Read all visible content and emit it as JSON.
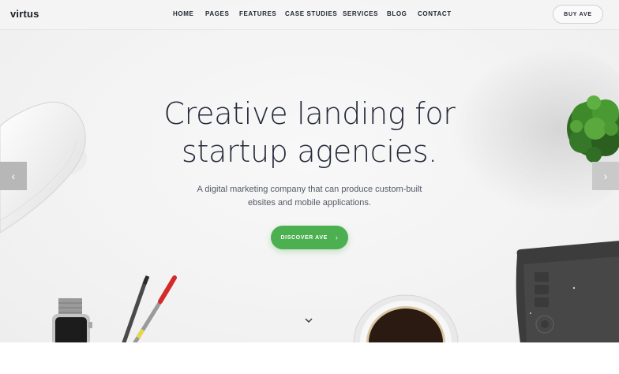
{
  "header": {
    "logo": "virtus",
    "nav": [
      "HOME",
      "PAGES",
      "FEATURES",
      "CASE STUDIES",
      "SERVICES",
      "BLOG",
      "CONTACT"
    ],
    "buy_button": "BUY AVE"
  },
  "hero": {
    "headline_line1": "Creative landing for",
    "headline_line2": "startup agencies.",
    "subtext_line1": "A digital marketing company that can produce custom-built",
    "subtext_line2": "ebsites and mobile applications.",
    "cta_label": "DISCOVER AVE",
    "cta_color": "#4caf50"
  },
  "icons": {
    "prev": "chevron-left-icon",
    "next": "chevron-right-icon",
    "scroll": "chevron-down-icon",
    "cta_arrow": "chevron-right-icon"
  }
}
